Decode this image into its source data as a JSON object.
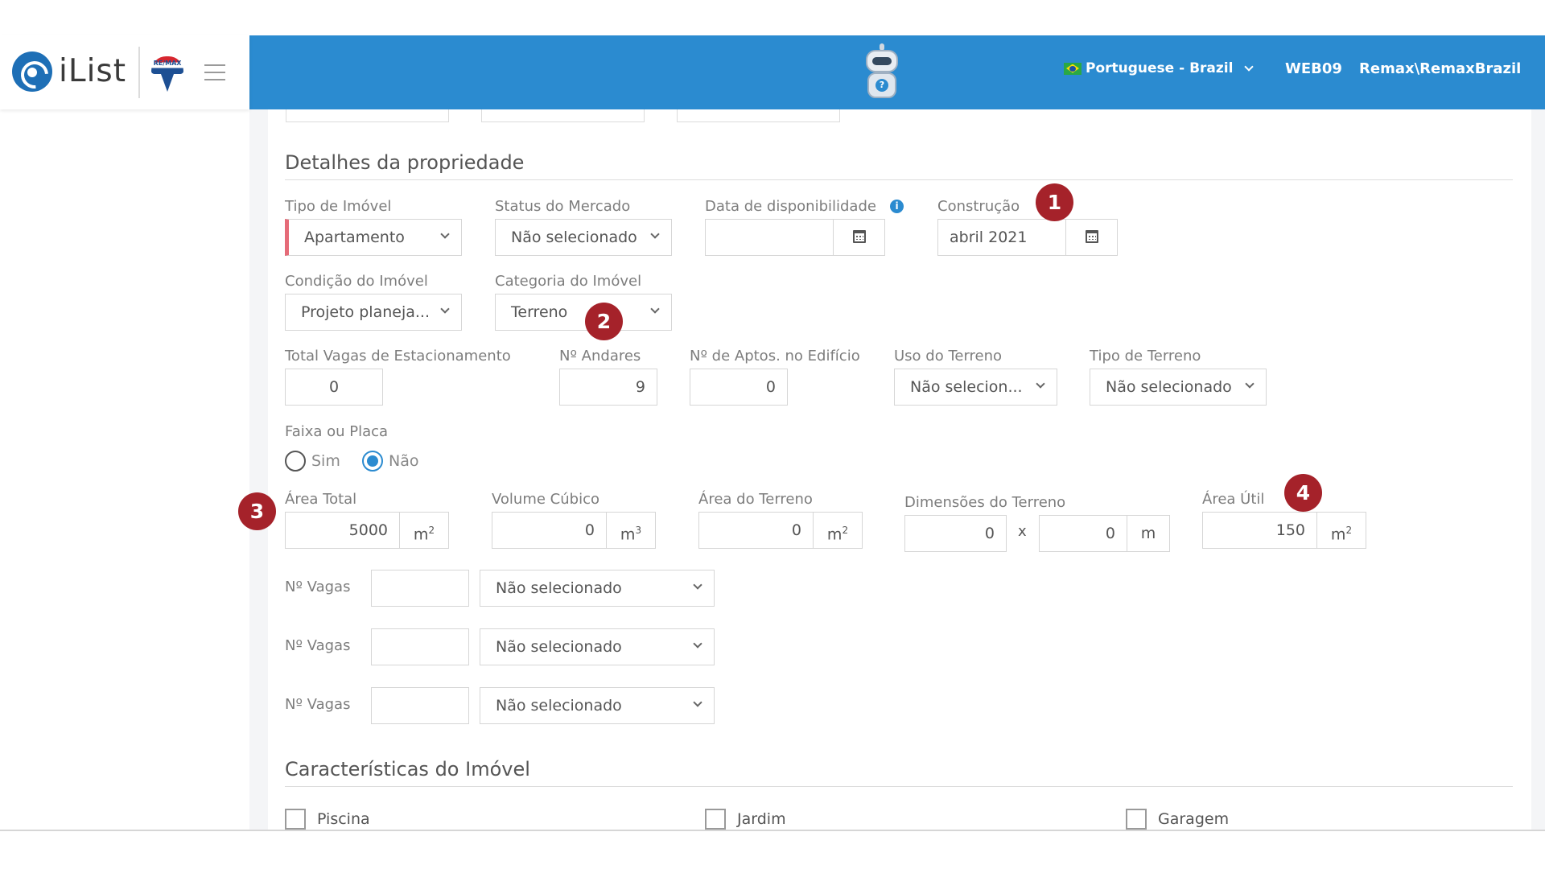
{
  "brand": {
    "name": "iList",
    "partner_logo_text": "RE/MAX"
  },
  "header": {
    "language": "Portuguese - Brazil",
    "office_code": "WEB09",
    "user": "Remax\\RemaxBrazil"
  },
  "sections": {
    "details_title": "Detalhes da propriedade",
    "features_title": "Características do Imóvel"
  },
  "fields": {
    "tipo_imovel": {
      "label": "Tipo de Imóvel",
      "value": "Apartamento"
    },
    "status_mercado": {
      "label": "Status do Mercado",
      "value": "Não selecionado"
    },
    "data_disponibilidade": {
      "label": "Data de disponibilidade",
      "value": ""
    },
    "construcao": {
      "label": "Construção",
      "value": "abril 2021"
    },
    "condicao_imovel": {
      "label": "Condição do Imóvel",
      "value": "Projeto planeja..."
    },
    "categoria_imovel": {
      "label": "Categoria do Imóvel",
      "value": "Terreno"
    },
    "total_vagas": {
      "label": "Total Vagas de Estacionamento",
      "value": "0"
    },
    "n_andares": {
      "label": "Nº Andares",
      "value": "9"
    },
    "n_aptos": {
      "label": "Nº de Aptos. no Edifício",
      "value": "0"
    },
    "uso_terreno": {
      "label": "Uso do Terreno",
      "value": "Não selecion..."
    },
    "tipo_terreno": {
      "label": "Tipo de Terreno",
      "value": "Não selecionado"
    },
    "faixa_placa": {
      "label": "Faixa ou Placa",
      "options": [
        "Sim",
        "Não"
      ],
      "selected": "Não"
    },
    "area_total": {
      "label": "Área Total",
      "value": "5000",
      "unit": "m",
      "unit_sup": "2"
    },
    "volume_cubico": {
      "label": "Volume Cúbico",
      "value": "0",
      "unit": "m",
      "unit_sup": "3"
    },
    "area_terreno": {
      "label": "Área do Terreno",
      "value": "0",
      "unit": "m",
      "unit_sup": "2"
    },
    "dimensoes_terreno": {
      "label": "Dimensões do Terreno",
      "value_a": "0",
      "separator": "x",
      "value_b": "0",
      "unit": "m"
    },
    "area_util": {
      "label": "Área Útil",
      "value": "150",
      "unit": "m",
      "unit_sup": "2"
    }
  },
  "vagas_rows": [
    {
      "label": "Nº Vagas",
      "value": "",
      "select": "Não selecionado"
    },
    {
      "label": "Nº Vagas",
      "value": "",
      "select": "Não selecionado"
    },
    {
      "label": "Nº Vagas",
      "value": "",
      "select": "Não selecionado"
    }
  ],
  "features": [
    {
      "label": "Piscina",
      "checked": false
    },
    {
      "label": "Jardim",
      "checked": false
    },
    {
      "label": "Garagem",
      "checked": false
    }
  ],
  "badges": [
    "1",
    "2",
    "3",
    "4"
  ]
}
